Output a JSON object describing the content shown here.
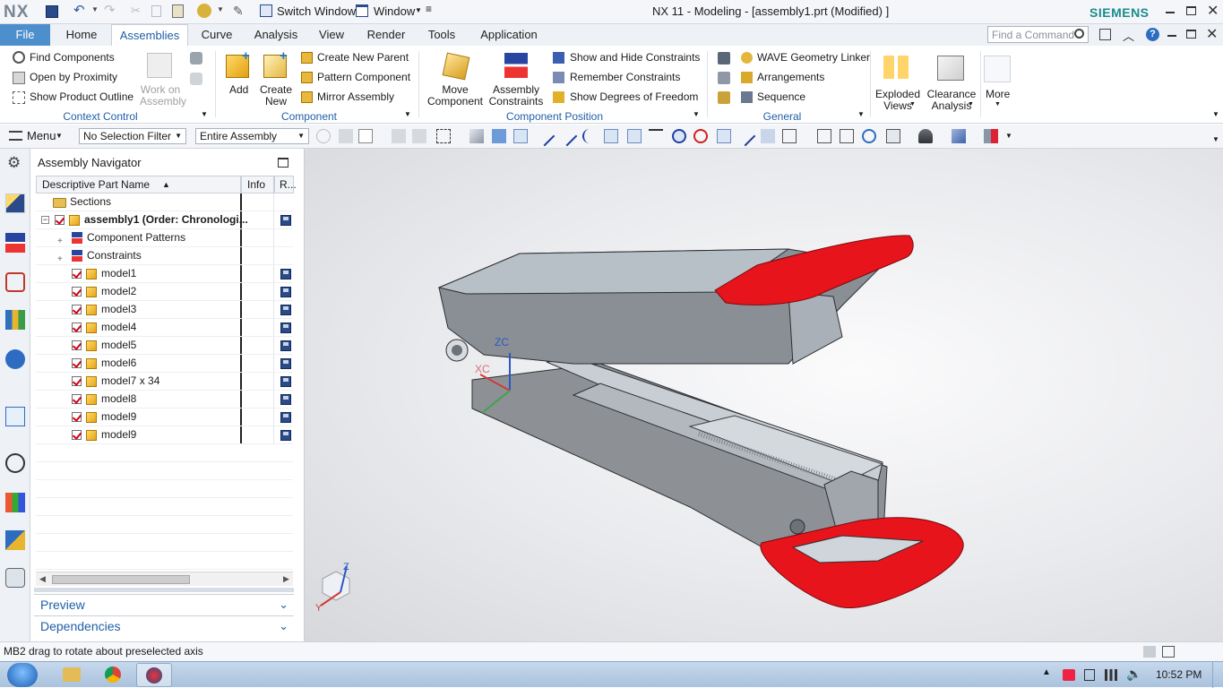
{
  "titlebar": {
    "logo": "NX",
    "switch_window": "Switch Window",
    "window_menu": "Window",
    "title": "NX 11 - Modeling - [assembly1.prt (Modified) ]",
    "brand": "SIEMENS"
  },
  "tabs": [
    "File",
    "Home",
    "Assemblies",
    "Curve",
    "Analysis",
    "View",
    "Render",
    "Tools",
    "Application"
  ],
  "search": {
    "placeholder": "Find a Command"
  },
  "ribbon": {
    "context_control": {
      "label": "Context Control",
      "items": [
        "Find Components",
        "Open by Proximity",
        "Show Product Outline",
        "Work on Assembly"
      ]
    },
    "component": {
      "label": "Component",
      "add": "Add",
      "create_new": "Create New",
      "items": [
        "Create New Parent",
        "Pattern Component",
        "Mirror Assembly"
      ]
    },
    "component_position": {
      "label": "Component Position",
      "move_component": "Move Component",
      "assembly_constraints": "Assembly Constraints",
      "items": [
        "Show and Hide Constraints",
        "Remember Constraints",
        "Show Degrees of Freedom"
      ]
    },
    "general": {
      "label": "General",
      "items": [
        "WAVE Geometry Linker",
        "Arrangements",
        "Sequence"
      ]
    },
    "exploded_views": "Exploded Views",
    "clearance_analysis": "Clearance Analysis",
    "more": "More"
  },
  "toolbar2": {
    "menu": "Menu",
    "selection_filter": "No Selection Filter",
    "scope": "Entire Assembly"
  },
  "navigator": {
    "title": "Assembly Navigator",
    "columns": [
      "Descriptive Part Name",
      "Info",
      "R..."
    ],
    "rows": [
      {
        "name": "Sections",
        "type": "folder",
        "indent": 1
      },
      {
        "name": "assembly1 (Order: Chronologi...",
        "type": "assembly",
        "indent": 0,
        "bold": true,
        "saved": true
      },
      {
        "name": "Component Patterns",
        "type": "patterns",
        "indent": 1
      },
      {
        "name": "Constraints",
        "type": "constraints",
        "indent": 1
      },
      {
        "name": "model1",
        "type": "part",
        "indent": 2,
        "saved": true
      },
      {
        "name": "model2",
        "type": "part",
        "indent": 2,
        "saved": true
      },
      {
        "name": "model3",
        "type": "part",
        "indent": 2,
        "saved": true
      },
      {
        "name": "model4",
        "type": "part",
        "indent": 2,
        "saved": true
      },
      {
        "name": "model5",
        "type": "part",
        "indent": 2,
        "saved": true
      },
      {
        "name": "model6",
        "type": "part",
        "indent": 2,
        "saved": true
      },
      {
        "name": "model7 x 34",
        "type": "part",
        "indent": 2,
        "saved": true
      },
      {
        "name": "model8",
        "type": "part",
        "indent": 2,
        "saved": true
      },
      {
        "name": "model9",
        "type": "part",
        "indent": 2,
        "saved": true
      },
      {
        "name": "model9",
        "type": "part",
        "indent": 2,
        "saved": true
      }
    ],
    "preview": "Preview",
    "dependencies": "Dependencies"
  },
  "viewport": {
    "axis_zc": "ZC",
    "axis_xc": "XC",
    "triad_z": "Z",
    "triad_y": "Y"
  },
  "status": {
    "message": "MB2 drag to rotate about preselected axis"
  },
  "taskbar": {
    "time": "10:52 PM"
  },
  "colors": {
    "accent": "#1f5fa8",
    "red_part": "#e8141b",
    "body_gray": "#8a8f95"
  }
}
